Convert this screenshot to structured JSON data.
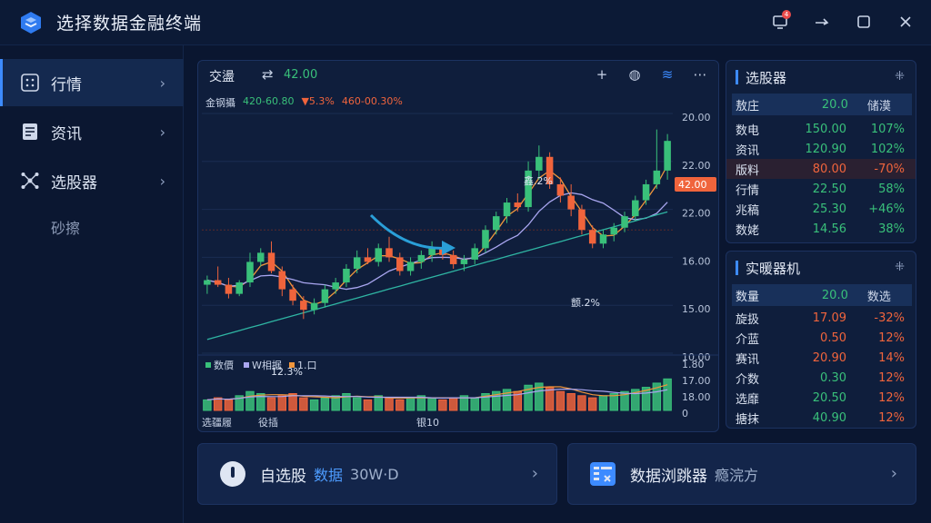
{
  "app": {
    "title": "选择数据金融终端"
  },
  "window_controls": {
    "notification_count": "4"
  },
  "sidebar": {
    "items": [
      {
        "label": "行情",
        "icon": "grid-icon"
      },
      {
        "label": "资讯",
        "icon": "document-icon"
      },
      {
        "label": "选股器",
        "icon": "network-icon"
      }
    ],
    "sub_label": "砂擦"
  },
  "chart_panel": {
    "title": "交盪",
    "value": "42.00",
    "legend": [
      {
        "text": "金钢攝",
        "cls": ""
      },
      {
        "text": "420-60.80",
        "cls": "up"
      },
      {
        "text": "▼5.3%",
        "cls": "dn"
      },
      {
        "text": "460-00.30%",
        "cls": "dn"
      }
    ],
    "price_axis": [
      "20.00",
      "22.00",
      "22.00",
      "16.00",
      "15.00",
      "10.00"
    ],
    "price_tag": "42.00",
    "annotations": [
      "鑫.2%",
      "颤.2%",
      "12.3%"
    ],
    "volume_legend": [
      "数價",
      "W相据",
      "1.口"
    ],
    "volume_axis": [
      "1.80",
      "17.00",
      "18.00",
      "0"
    ],
    "x_labels": [
      "选疆履",
      "役插",
      "银10"
    ]
  },
  "chart_data": {
    "type": "candlestick",
    "candles": [
      [
        16.0,
        16.4,
        15.6,
        16.2
      ],
      [
        16.2,
        16.8,
        15.9,
        16.0
      ],
      [
        16.0,
        16.3,
        15.4,
        15.6
      ],
      [
        15.6,
        16.2,
        15.5,
        16.1
      ],
      [
        16.1,
        17.4,
        15.9,
        17.0
      ],
      [
        17.0,
        17.6,
        16.8,
        17.4
      ],
      [
        17.4,
        17.9,
        16.5,
        16.6
      ],
      [
        16.6,
        16.8,
        15.5,
        15.8
      ],
      [
        15.8,
        16.0,
        15.1,
        15.3
      ],
      [
        15.3,
        15.5,
        14.5,
        14.9
      ],
      [
        14.9,
        15.4,
        14.7,
        15.2
      ],
      [
        15.2,
        16.0,
        15.0,
        15.8
      ],
      [
        15.8,
        16.3,
        15.6,
        16.1
      ],
      [
        16.1,
        16.9,
        15.9,
        16.7
      ],
      [
        16.7,
        17.5,
        16.5,
        17.2
      ],
      [
        17.2,
        17.6,
        16.9,
        17.0
      ],
      [
        17.0,
        17.8,
        16.8,
        17.6
      ],
      [
        17.6,
        18.1,
        17.0,
        17.2
      ],
      [
        17.2,
        17.4,
        16.4,
        16.6
      ],
      [
        16.6,
        17.2,
        16.4,
        17.0
      ],
      [
        17.0,
        17.5,
        16.7,
        17.3
      ],
      [
        17.3,
        17.9,
        17.0,
        17.6
      ],
      [
        17.6,
        17.9,
        17.1,
        17.3
      ],
      [
        17.3,
        17.5,
        16.7,
        16.9
      ],
      [
        16.9,
        17.3,
        16.6,
        17.1
      ],
      [
        17.1,
        17.8,
        16.9,
        17.6
      ],
      [
        17.6,
        18.6,
        17.4,
        18.4
      ],
      [
        18.4,
        19.2,
        18.2,
        19.0
      ],
      [
        19.0,
        19.8,
        18.7,
        19.6
      ],
      [
        19.6,
        20.0,
        19.2,
        19.4
      ],
      [
        19.4,
        21.4,
        19.2,
        21.0
      ],
      [
        21.0,
        22.1,
        20.6,
        21.6
      ],
      [
        21.6,
        21.8,
        20.2,
        20.4
      ],
      [
        20.4,
        20.7,
        19.6,
        19.9
      ],
      [
        19.9,
        20.4,
        19.0,
        19.3
      ],
      [
        19.3,
        19.5,
        18.2,
        18.4
      ],
      [
        18.4,
        18.6,
        17.6,
        17.8
      ],
      [
        17.8,
        18.4,
        17.6,
        18.2
      ],
      [
        18.2,
        18.7,
        17.9,
        18.5
      ],
      [
        18.5,
        19.2,
        18.3,
        19.0
      ],
      [
        19.0,
        19.9,
        18.8,
        19.7
      ],
      [
        19.7,
        20.6,
        19.5,
        20.4
      ],
      [
        20.4,
        22.8,
        20.2,
        21.0
      ],
      [
        21.0,
        22.6,
        20.6,
        22.3
      ]
    ],
    "volumes": [
      5,
      6,
      5,
      7,
      9,
      8,
      6,
      7,
      8,
      6,
      5,
      6,
      7,
      8,
      6,
      5,
      7,
      6,
      5,
      6,
      7,
      6,
      5,
      6,
      7,
      6,
      8,
      9,
      10,
      9,
      12,
      13,
      11,
      9,
      8,
      7,
      6,
      7,
      8,
      9,
      10,
      11,
      13,
      15
    ],
    "ylim": [
      13.0,
      23.5
    ],
    "price_axis_labels": [
      "20.00",
      "22.00",
      "22.00",
      "16.00",
      "15.00",
      "10.00"
    ]
  },
  "stock_picker": {
    "title": "选股器",
    "header": [
      "敖庄",
      "20.0",
      "储漠"
    ],
    "rows": [
      {
        "name": "数电",
        "val": "150.00",
        "pct": "107%",
        "pc": "g",
        "vc": "g",
        "hl": false
      },
      {
        "name": "资讯",
        "val": "120.90",
        "pct": "102%",
        "pc": "g",
        "vc": "g",
        "hl": false
      },
      {
        "name": "版料",
        "val": "80.00",
        "pct": "-70%",
        "pc": "r",
        "vc": "r",
        "hl": true
      },
      {
        "name": "行情",
        "val": "22.50",
        "pct": "58%",
        "pc": "g",
        "vc": "g",
        "hl": false
      },
      {
        "name": "兆稿",
        "val": "25.30",
        "pct": "+46%",
        "pc": "g",
        "vc": "g",
        "hl": false
      },
      {
        "name": "数姥",
        "val": "14.56",
        "pct": "38%",
        "pc": "g",
        "vc": "g",
        "hl": false
      }
    ]
  },
  "realtime": {
    "title": "实暖器机",
    "header": [
      "数量",
      "20.0",
      "数选"
    ],
    "rows": [
      {
        "name": "旋扱",
        "val": "17.09",
        "pct": "-32%",
        "pc": "r",
        "vc": "r"
      },
      {
        "name": "介蓝",
        "val": "0.50",
        "pct": "12%",
        "pc": "r",
        "vc": "r"
      },
      {
        "name": "赛讯",
        "val": "20.90",
        "pct": "14%",
        "pc": "r",
        "vc": "r"
      },
      {
        "name": "介数",
        "val": "0.30",
        "pct": "12%",
        "pc": "r",
        "vc": "g"
      },
      {
        "name": "选靡",
        "val": "20.50",
        "pct": "12%",
        "pc": "r",
        "vc": "g"
      },
      {
        "name": "搪抹",
        "val": "40.90",
        "pct": "12%",
        "pc": "r",
        "vc": "g"
      }
    ]
  },
  "bottom": {
    "card1": {
      "label": "自选股",
      "link": "数据",
      "sub": "30W·D"
    },
    "card2": {
      "label": "数据浏跳器",
      "sub": "瘾浣方"
    }
  },
  "colors": {
    "up": "#39c07a",
    "down": "#f0643c",
    "accent": "#3d8bff",
    "bg": "#0a1630"
  }
}
